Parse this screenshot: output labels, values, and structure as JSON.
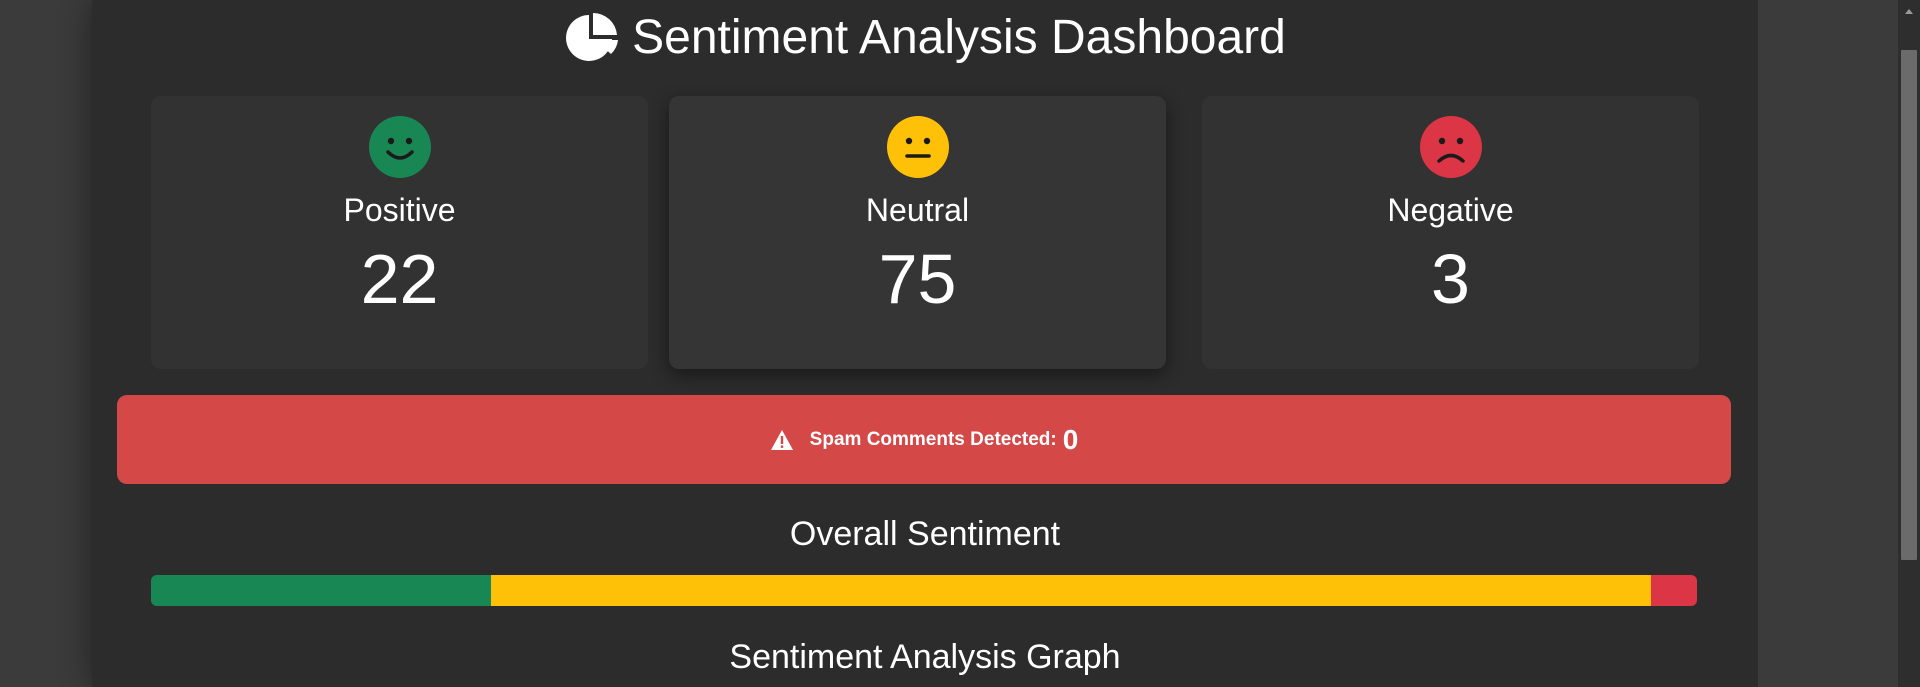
{
  "title": "Sentiment Analysis Dashboard",
  "title_icon": "pie-chart-icon",
  "cards": [
    {
      "label": "Positive",
      "value": "22",
      "icon": "smile-icon",
      "color": "#198754"
    },
    {
      "label": "Neutral",
      "value": "75",
      "icon": "neutral-face-icon",
      "color": "#ffc107"
    },
    {
      "label": "Negative",
      "value": "3",
      "icon": "frown-icon",
      "color": "#dc3545"
    }
  ],
  "spam": {
    "label": "Spam Comments Detected:",
    "count": "0",
    "icon": "warning-icon",
    "color": "#d44848"
  },
  "overall": {
    "title": "Overall Sentiment",
    "segments": [
      {
        "name": "positive",
        "percent": 22,
        "color": "#198754"
      },
      {
        "name": "neutral",
        "percent": 75,
        "color": "#ffc107"
      },
      {
        "name": "negative",
        "percent": 3,
        "color": "#dc3545"
      }
    ]
  },
  "graph_title": "Sentiment Analysis Graph"
}
